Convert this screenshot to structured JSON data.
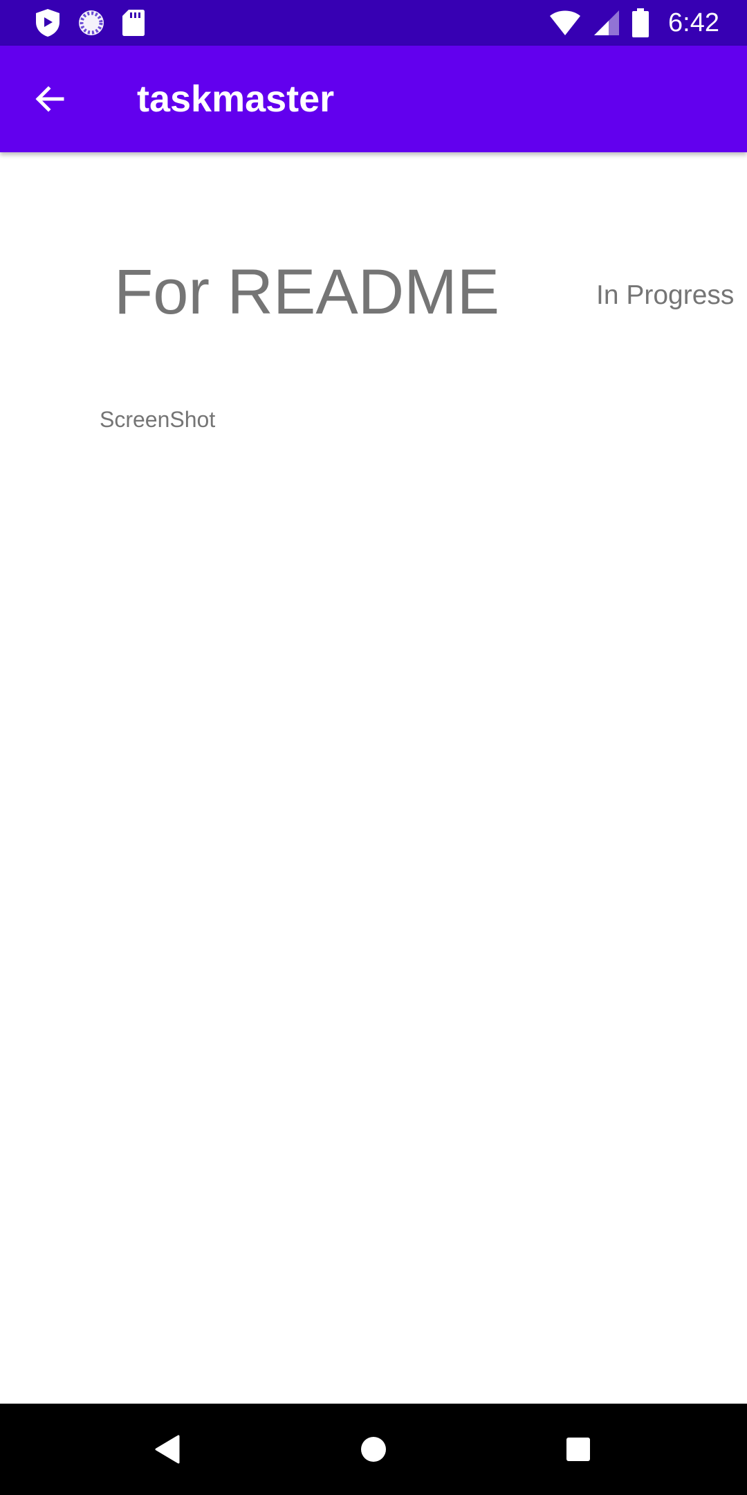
{
  "status_bar": {
    "time": "6:42",
    "left_icons": [
      "shield-icon",
      "loading-spinner-icon",
      "sd-card-icon"
    ],
    "right_icons": [
      "wifi-icon",
      "cell-signal-icon",
      "battery-icon"
    ],
    "background": "#3700B3"
  },
  "app_bar": {
    "title": "taskmaster",
    "background": "#6200EE",
    "back_icon": "arrow-back-icon"
  },
  "task": {
    "title": "For README",
    "state": "In Progress",
    "body": "ScreenShot"
  },
  "nav_bar": {
    "icons": [
      "back-triangle-icon",
      "home-circle-icon",
      "recents-square-icon"
    ],
    "background": "#000000"
  }
}
